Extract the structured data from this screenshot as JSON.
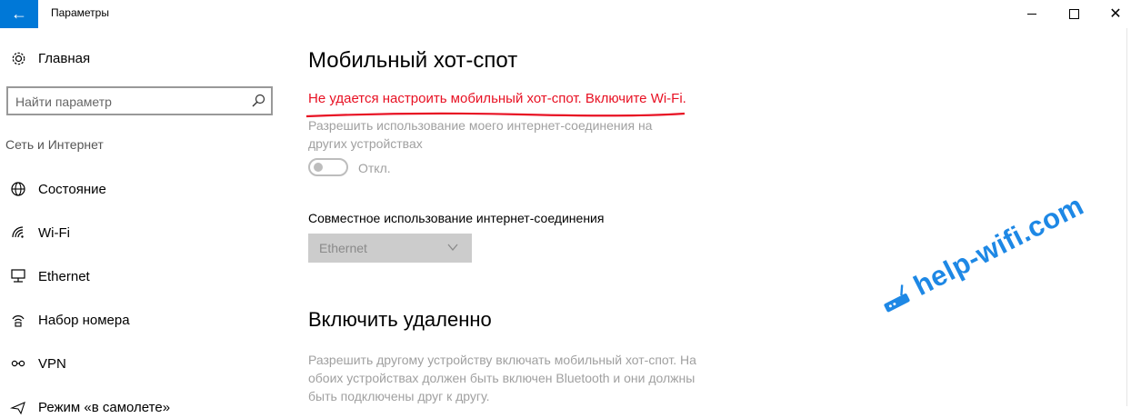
{
  "window": {
    "title": "Параметры",
    "back_icon": "arrow-left-icon",
    "controls": [
      "minimize",
      "maximize",
      "close"
    ]
  },
  "sidebar": {
    "home_label": "Главная",
    "search_placeholder": "Найти параметр",
    "section_label": "Сеть и Интернет",
    "items": [
      {
        "label": "Состояние",
        "icon": "globe-icon"
      },
      {
        "label": "Wi-Fi",
        "icon": "wifi-icon"
      },
      {
        "label": "Ethernet",
        "icon": "ethernet-icon"
      },
      {
        "label": "Набор номера",
        "icon": "dialup-icon"
      },
      {
        "label": "VPN",
        "icon": "vpn-icon"
      },
      {
        "label": "Режим «в самолете»",
        "icon": "airplane-icon"
      }
    ]
  },
  "main": {
    "title": "Мобильный хот-спот",
    "error": "Не удается настроить мобильный хот-спот. Включите Wi-Fi.",
    "share_desc": "Разрешить использование моего интернет-соединения на других устройствах",
    "toggle_state": "Откл.",
    "sharing_title": "Совместное использование интернет-соединения",
    "sharing_dropdown": "Ethernet",
    "remote_title": "Включить удаленно",
    "remote_desc": "Разрешить другому устройству включать мобильный хот-спот. На обоих устройствах должен быть включен Bluetooth и они должны быть подключены друг к другу."
  },
  "watermark": {
    "text": "help-wifi.com"
  },
  "colors": {
    "accent": "#0078d7",
    "error": "#e81123",
    "disabled_text": "#a0a0a0",
    "watermark": "#1e88e5"
  }
}
